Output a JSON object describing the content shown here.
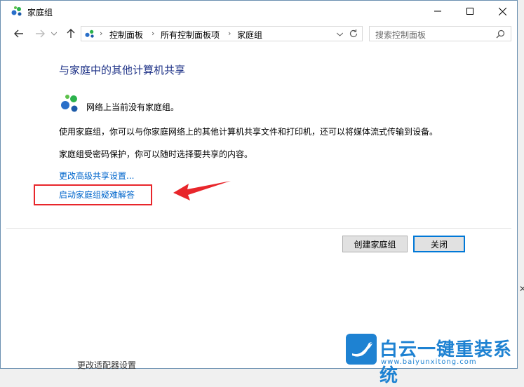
{
  "window": {
    "title": "家庭组"
  },
  "address": {
    "segments": [
      "控制面板",
      "所有控制面板项",
      "家庭组"
    ]
  },
  "search": {
    "placeholder": "搜索控制面板"
  },
  "main": {
    "heading": "与家庭中的其他计算机共享",
    "status": "网络上当前没有家庭组。",
    "description1": "使用家庭组，你可以与你家庭网络上的其他计算机共享文件和打印机，还可以将媒体流式传输到设备。",
    "description2": "家庭组受密码保护，你可以随时选择要共享的内容。",
    "link_advanced": "更改高级共享设置...",
    "link_troubleshoot": "启动家庭组疑难解答"
  },
  "buttons": {
    "create": "创建家庭组",
    "close": "关闭"
  },
  "background": {
    "partial_text": "更改适配器设置"
  },
  "watermark": {
    "brand": "白云一键重装系统",
    "url": "www.baiyunxitong.com"
  },
  "colors": {
    "heading": "#1e3287",
    "link": "#0066cc",
    "highlight_box": "#e8262b",
    "watermark": "#1e82d2"
  },
  "icons": [
    "homegroup-icon",
    "back-arrow-icon",
    "forward-arrow-icon",
    "up-arrow-icon",
    "dropdown-chevron-icon",
    "refresh-icon",
    "search-icon"
  ]
}
